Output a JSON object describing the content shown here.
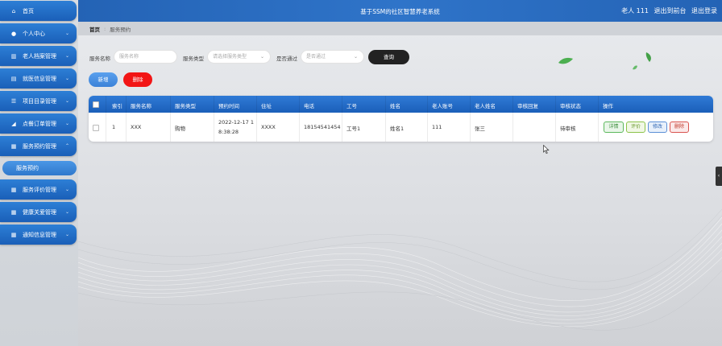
{
  "topbar": {
    "title": "基于SSM的社区智慧养老系统",
    "user": "老人 111",
    "back_link": "退出到前台",
    "logout": "退出登录"
  },
  "sidebar": {
    "items": [
      {
        "label": "首页",
        "icon": "home-icon",
        "chevron": false
      },
      {
        "label": "个人中心",
        "icon": "user-icon",
        "chevron": true
      },
      {
        "label": "老人档案管理",
        "icon": "bar-chart-icon",
        "chevron": true
      },
      {
        "label": "就医信息管理",
        "icon": "clipboard-icon",
        "chevron": true
      },
      {
        "label": "项目目录管理",
        "icon": "list-icon",
        "chevron": true
      },
      {
        "label": "点餐订单管理",
        "icon": "area-chart-icon",
        "chevron": true
      },
      {
        "label": "服务预约管理",
        "icon": "grid-icon",
        "chevron": true
      },
      {
        "label": "服务评价管理",
        "icon": "grid-icon",
        "chevron": true
      },
      {
        "label": "健康关爱管理",
        "icon": "grid-icon",
        "chevron": true
      },
      {
        "label": "通知信息管理",
        "icon": "grid-icon",
        "chevron": true
      }
    ],
    "active_sub": "服务预约"
  },
  "breadcrumb": {
    "home": "首页",
    "current": "服务预约"
  },
  "search": {
    "name_label": "服务名称",
    "name_placeholder": "服务名称",
    "type_label": "服务类型",
    "type_placeholder": "请选择服务类型",
    "pass_label": "是否通过",
    "pass_placeholder": "是否通过",
    "search_button": "查询"
  },
  "actions": {
    "add": "新增",
    "delete": "删除"
  },
  "table": {
    "headers": [
      "索引",
      "服务名称",
      "服务类型",
      "预约时间",
      "住址",
      "电话",
      "工号",
      "姓名",
      "老人账号",
      "老人姓名",
      "审核回复",
      "审核状态",
      "操作"
    ],
    "rows": [
      {
        "index": "1",
        "service_name": "XXX",
        "service_type": "购物",
        "time_line1": "2022-12-17 1",
        "time_line2": "8:38:28",
        "address": "XXXX",
        "phone": "18154541454",
        "staff_no": "工号1",
        "staff_name": "姓名1",
        "elder_account": "111",
        "elder_name": "张三",
        "reply": "",
        "status": "待审核",
        "ops": [
          "详情",
          "评价",
          "修改",
          "删除"
        ]
      }
    ]
  },
  "colors": {
    "primary": "#1a5fb8",
    "danger": "#f21515",
    "dark_button": "#222222"
  }
}
